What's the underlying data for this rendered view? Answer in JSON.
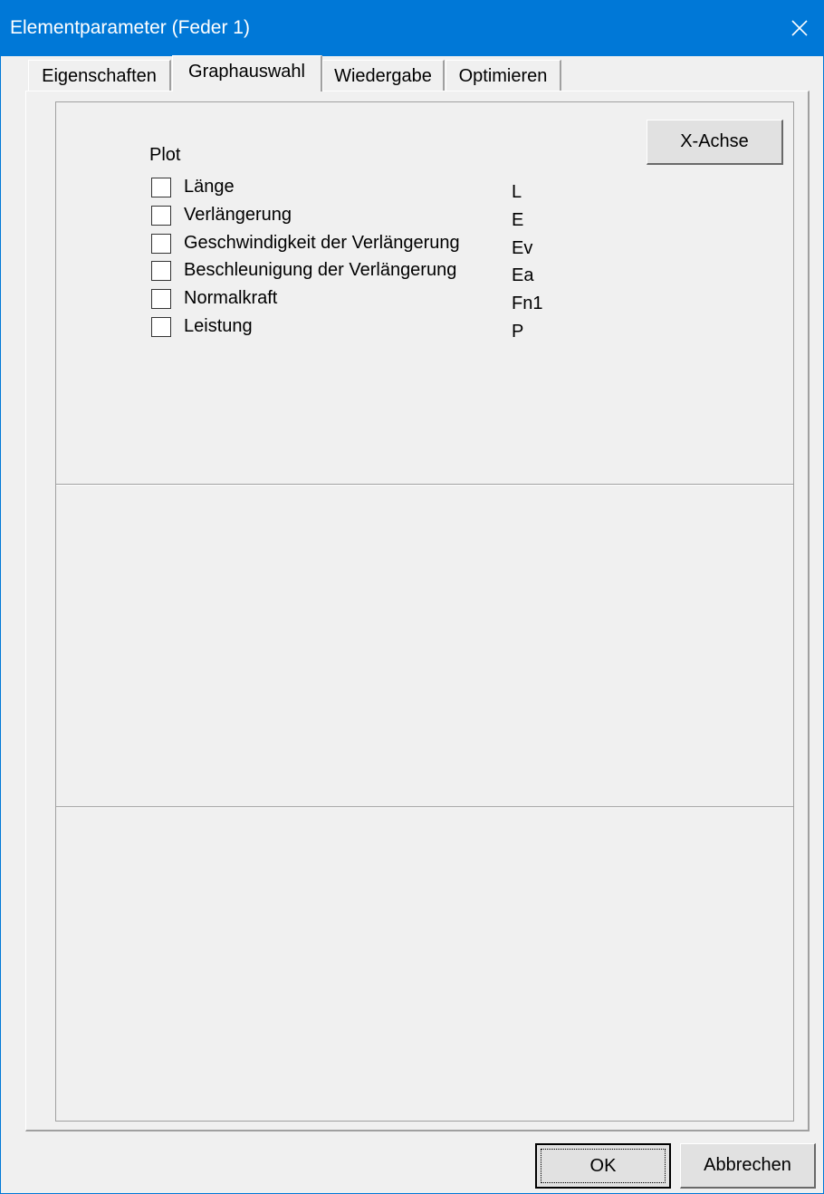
{
  "window": {
    "title": "Elementparameter (Feder 1)",
    "title_bar_color": "#0078d7",
    "close_icon": "close-icon"
  },
  "tabs": [
    {
      "label": "Eigenschaften",
      "active": false
    },
    {
      "label": "Graphauswahl",
      "active": true
    },
    {
      "label": "Wiedergabe",
      "active": false
    },
    {
      "label": "Optimieren",
      "active": false
    }
  ],
  "graph_selection": {
    "x_axis_button": "X-Achse",
    "plot_label": "Plot",
    "items": [
      {
        "label": "Länge",
        "symbol": "L",
        "checked": false
      },
      {
        "label": "Verlängerung",
        "symbol": "E",
        "checked": false
      },
      {
        "label": "Geschwindigkeit der Verlängerung",
        "symbol": "Ev",
        "checked": false
      },
      {
        "label": "Beschleunigung der Verlängerung",
        "symbol": "Ea",
        "checked": false
      },
      {
        "label": "Normalkraft",
        "symbol": "Fn1",
        "checked": false
      },
      {
        "label": "Leistung",
        "symbol": "P",
        "checked": false
      }
    ]
  },
  "footer": {
    "ok_label": "OK",
    "cancel_label": "Abbrechen"
  }
}
